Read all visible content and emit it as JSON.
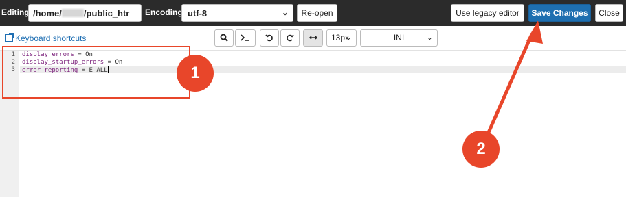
{
  "topbar": {
    "editing_label": "Editing:",
    "path_prefix": "/home/",
    "path_suffix": "/public_htr",
    "encoding_label": "Encoding:",
    "encoding_value": "utf-8",
    "reopen_label": "Re-open",
    "legacy_label": "Use legacy editor",
    "save_label": "Save Changes",
    "close_label": "Close",
    "accent_color": "#1e6fb0"
  },
  "toolbar": {
    "keyboard_shortcuts": "Keyboard shortcuts",
    "font_size": "13px",
    "mode": "INI",
    "icons": [
      "search-icon",
      "terminal-icon",
      "undo-icon",
      "redo-icon",
      "wrap-icon"
    ]
  },
  "editor": {
    "lines": [
      {
        "num": "1",
        "key": "display_errors",
        "op": " = ",
        "val": "On"
      },
      {
        "num": "2",
        "key": "display_startup_errors",
        "op": " = ",
        "val": "On"
      },
      {
        "num": "3",
        "key": "error_reporting",
        "op": " = ",
        "val": "E_ALL"
      }
    ]
  },
  "annotations": {
    "badge1": "1",
    "badge2": "2",
    "color": "#e8462a"
  }
}
